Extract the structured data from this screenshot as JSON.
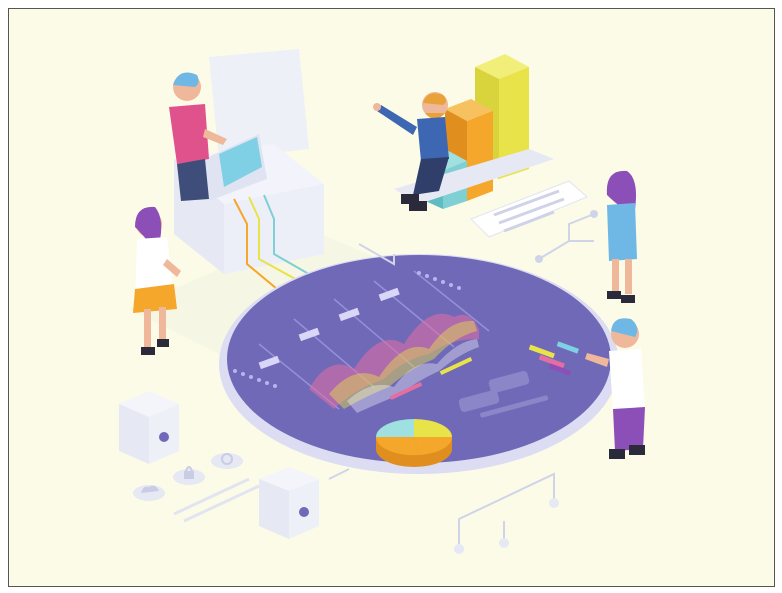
{
  "illustration": {
    "palette": {
      "background": "#fbfbe8",
      "platform": "#6f69b8",
      "platform_rim": "#dcdcf3",
      "accent_orange": "#f4a72a",
      "accent_yellow": "#e9e34a",
      "accent_teal": "#7fd0d4",
      "accent_pink": "#e46ea0",
      "accent_purple": "#8c4fb7"
    },
    "icons": [
      "computer-terminal-icon",
      "bar-chart-icon",
      "pie-chart-icon",
      "cloud-icon",
      "lock-icon",
      "gear-icon",
      "server-icon"
    ],
    "figures": [
      "person-at-computer",
      "person-seated-pointing",
      "person-standing-left",
      "person-standing-right-top",
      "person-standing-right-bottom"
    ]
  }
}
